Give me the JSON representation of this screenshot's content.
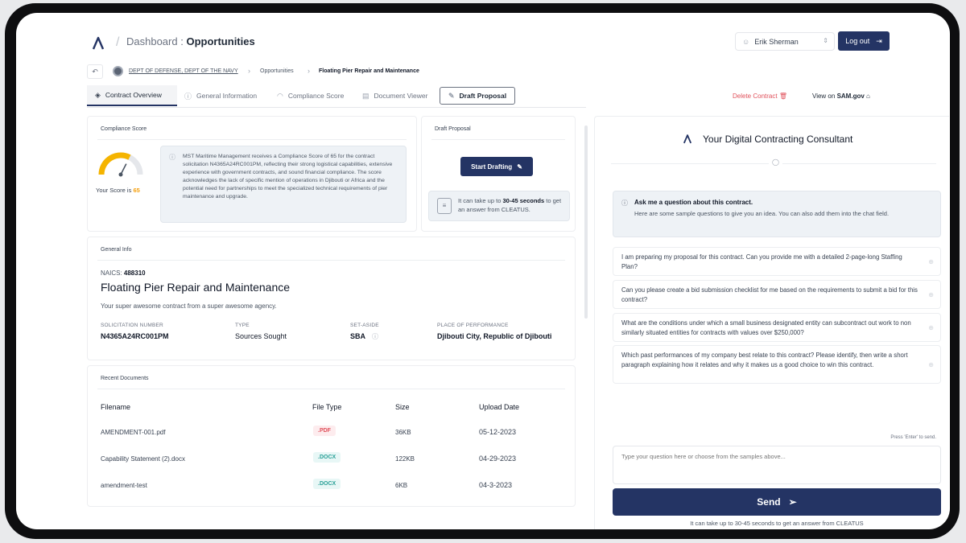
{
  "header": {
    "title_prefix": "Dashboard",
    "title_sep": ":",
    "title_page": "Opportunities",
    "user_name": "Erik Sherman",
    "logout_label": "Log out"
  },
  "breadcrumb": {
    "dept": "DEPT OF DEFENSE, DEPT OF THE NAVY",
    "opportunities": "Opportunities",
    "current": "Floating Pier Repair and Maintenance"
  },
  "tabs": {
    "contract_overview": "Contract Overview",
    "general_information": "General Information",
    "compliance_score": "Compliance Score",
    "document_viewer": "Document Viewer",
    "draft_proposal": "Draft Proposal"
  },
  "actions": {
    "delete_label": "Delete Contract",
    "view_on": "View on",
    "sam": "SAM.gov"
  },
  "compliance": {
    "card_title": "Compliance Score",
    "score_prefix": "Your Score is",
    "score": "65",
    "score_value": 65,
    "summary": "MST Maritime Management receives a Compliance Score of 65 for the contract solicitation N4365A24RC001PM, reflecting their strong logistical capabilities, extensive experience with government contracts, and sound financial compliance. The score acknowledges the lack of specific mention of operations in Djibouti or Africa and the potential need for partnerships to meet the specialized technical requirements of pier maintenance and upgrade."
  },
  "draft": {
    "card_title": "Draft Proposal",
    "start_label": "Start Drafting",
    "wait_prefix": "It can take up to",
    "wait_bold": "30-45 seconds",
    "wait_suffix": "to get an answer from CLEATUS."
  },
  "general": {
    "card_title": "General Info",
    "naics_label": "NAICS:",
    "naics_value": "488310",
    "title": "Floating Pier Repair and Maintenance",
    "description": "Your super awesome contract from a super awesome agency.",
    "fields": [
      {
        "label": "SOLICITATION NUMBER",
        "value": "N4365A24RC001PM"
      },
      {
        "label": "TYPE",
        "value": "Sources Sought"
      },
      {
        "label": "SET-ASIDE",
        "value": "SBA"
      },
      {
        "label": "PLACE OF PERFORMANCE",
        "value": "Djibouti City, Republic of Djibouti"
      }
    ]
  },
  "documents": {
    "card_title": "Recent Documents",
    "columns": [
      "Filename",
      "File Type",
      "Size",
      "Upload Date"
    ],
    "rows": [
      {
        "filename": "AMENDMENT-001.pdf",
        "type": ".PDF",
        "size": "36KB",
        "date": "05-12-2023"
      },
      {
        "filename": "Capability Statement (2).docx",
        "type": ".DOCX",
        "size": "122KB",
        "date": "04-29-2023"
      },
      {
        "filename": "amendment-test",
        "type": ".DOCX",
        "size": "6KB",
        "date": "04-3-2023"
      }
    ]
  },
  "chat": {
    "title": "Your Digital Contracting Consultant",
    "ask_title": "Ask me a question about this contract.",
    "ask_sub": "Here are some sample questions to give you an idea. You can also add them into the chat field.",
    "samples": [
      "I am preparing my proposal for this contract. Can you provide me with a detailed 2-page-long Staffing Plan?",
      "Can you please create a bid submission checklist for me based on the requirements to submit a bid for this contract?",
      "What are the conditions under which a small business designated entity can subcontract out work to non similarly situated entities for contracts with values over $250,000?",
      "Which past performances of my company best relate to this contract? Please identify, then write a short paragraph explaining how it relates and why it makes us a good choice to win this contract."
    ],
    "enter_hint": "Press 'Enter' to send.",
    "input_placeholder": "Type your question here or choose from the samples above...",
    "send_label": "Send",
    "send_note": "It can take up to 30-45 seconds to get an answer from CLEATUS"
  },
  "colors": {
    "primary": "#243464",
    "danger": "#e0515b",
    "score_accent": "#f59e0b",
    "docx": "#2aa198"
  }
}
